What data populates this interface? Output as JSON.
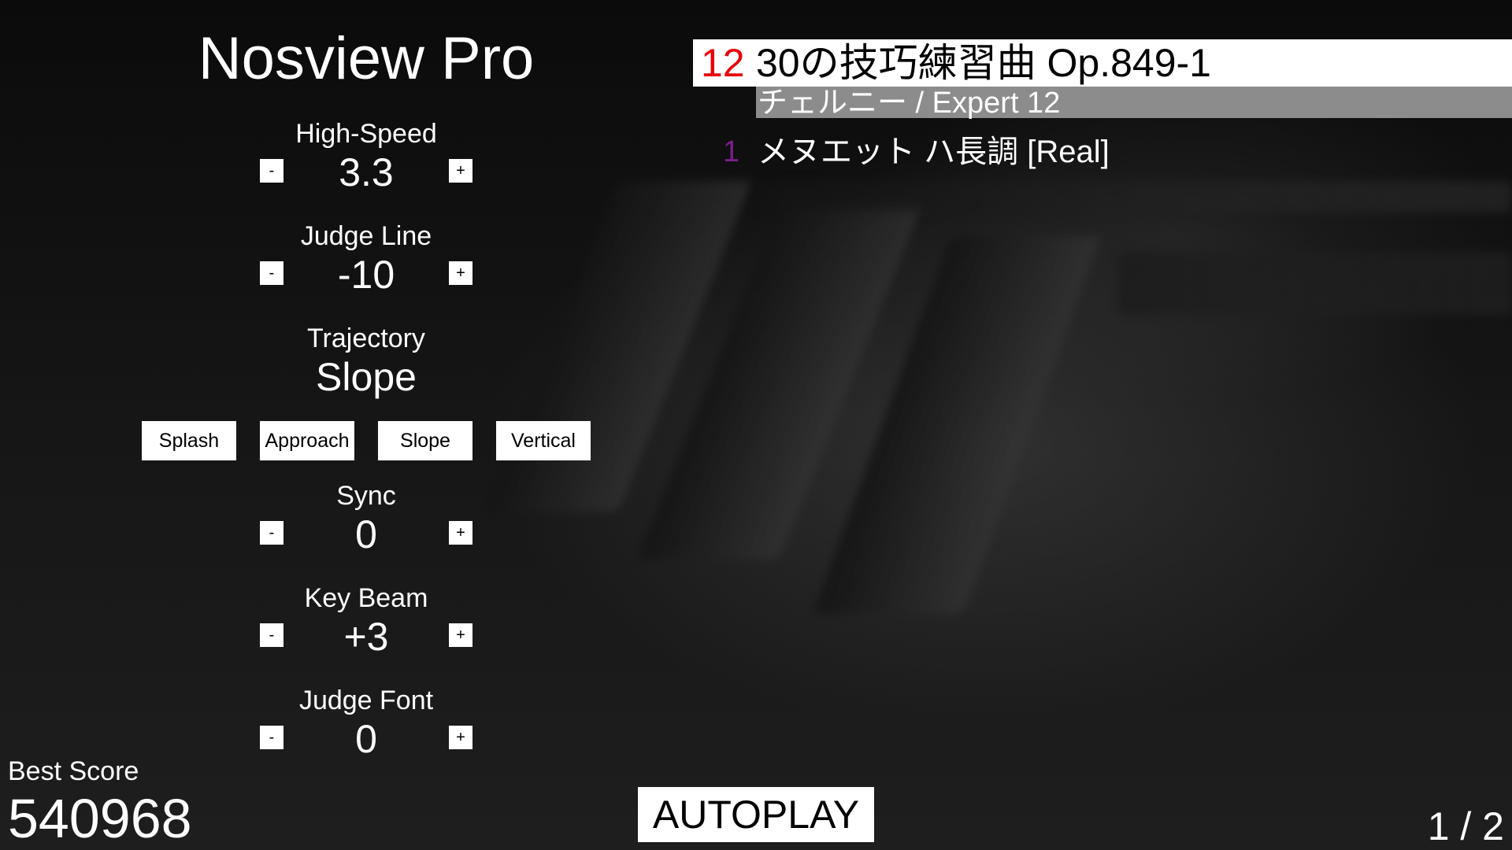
{
  "app": {
    "title": "Nosview Pro"
  },
  "settings": {
    "high_speed": {
      "label": "High-Speed",
      "value": "3.3",
      "minus": "-",
      "plus": "+"
    },
    "judge_line": {
      "label": "Judge Line",
      "value": "-10",
      "minus": "-",
      "plus": "+"
    },
    "trajectory": {
      "label": "Trajectory",
      "value": "Slope"
    },
    "sync": {
      "label": "Sync",
      "value": "0",
      "minus": "-",
      "plus": "+"
    },
    "key_beam": {
      "label": "Key Beam",
      "value": "+3",
      "minus": "-",
      "plus": "+"
    },
    "judge_font": {
      "label": "Judge Font",
      "value": "0",
      "minus": "-",
      "plus": "+"
    }
  },
  "trajectory_options": [
    "Splash",
    "Approach",
    "Slope",
    "Vertical"
  ],
  "score": {
    "label": "Best Score",
    "value": "540968"
  },
  "autoplay": {
    "label": "AUTOPLAY"
  },
  "pagination": {
    "text": "1 / 2"
  },
  "song_list": {
    "selected": {
      "level": "12",
      "title": "30の技巧練習曲 Op.849-1",
      "subtitle": "チェルニー / Expert 12"
    },
    "items": [
      {
        "level": "1",
        "title": "メヌエット ハ長調 [Real]"
      }
    ]
  },
  "colors": {
    "selected_level": "#e8000a",
    "item_level": "#7a1f8a",
    "subtitle_bar": "#8c8c8c"
  }
}
